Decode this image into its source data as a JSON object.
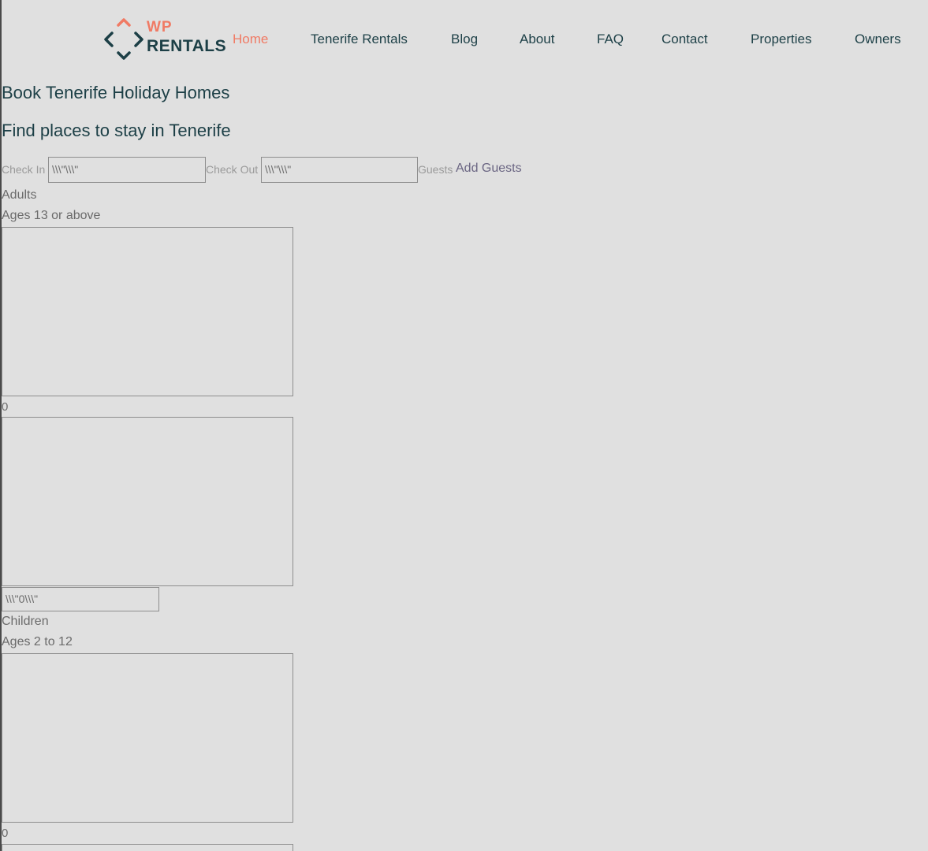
{
  "header": {
    "logo": {
      "top": "WP",
      "bottom": "RENTALS"
    },
    "nav": [
      {
        "label": "Home",
        "active": true
      },
      {
        "label": "Tenerife Rentals",
        "active": false
      },
      {
        "label": "Blog",
        "active": false
      },
      {
        "label": "About",
        "active": false
      },
      {
        "label": "FAQ",
        "active": false
      },
      {
        "label": "Contact",
        "active": false
      },
      {
        "label": "Properties",
        "active": false
      },
      {
        "label": "Owners",
        "active": false
      }
    ]
  },
  "main": {
    "title": "Book Tenerife Holiday Homes",
    "subtitle": "Find places to stay in Tenerife",
    "search": {
      "check_in_label": "Check In",
      "check_in_value": "\\\\\\\"\\\\\\\"",
      "check_out_label": "Check Out",
      "check_out_value": "\\\\\\\"\\\\\\\"",
      "guests_label": "Guests",
      "guests_value": "Add Guests"
    },
    "adults": {
      "label": "Adults",
      "hint": "Ages 13 or above",
      "count": "0",
      "input_value": "\\\\\\\"0\\\\\\\""
    },
    "children": {
      "label": "Children",
      "hint": "Ages 2 to 12",
      "count": "0"
    }
  },
  "colors": {
    "background": "#e0e0e0",
    "accent": "#f07a64",
    "brand_dark": "#1c3f46"
  }
}
